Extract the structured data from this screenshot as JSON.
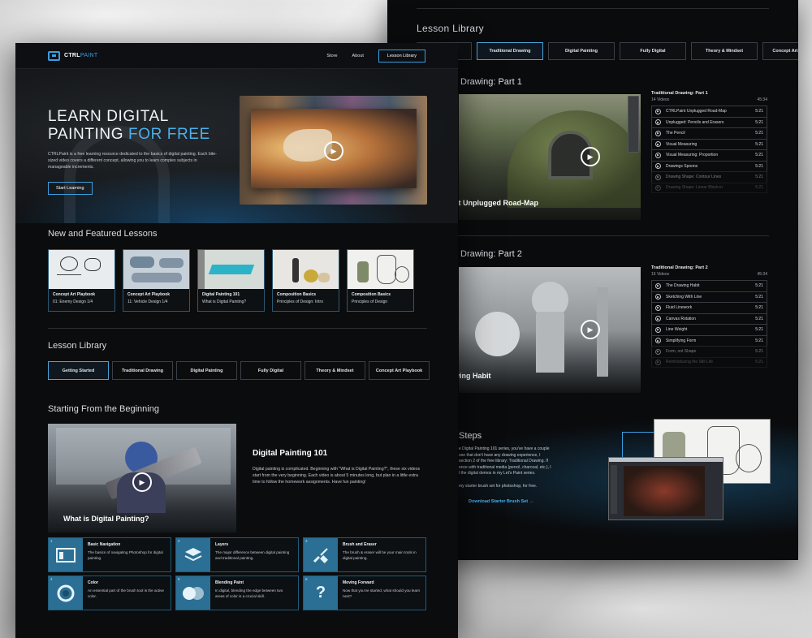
{
  "back_page": {
    "lesson_library_title": "Lesson Library",
    "tabs": [
      {
        "label": "",
        "active": false
      },
      {
        "label": "Traditional Drawing",
        "active": true
      },
      {
        "label": "Digital Painting",
        "active": false
      },
      {
        "label": "Fully Digital",
        "active": false
      },
      {
        "label": "Theory & Mindset",
        "active": false
      },
      {
        "label": "Concept Art Playbook",
        "active": false
      }
    ],
    "section1": {
      "title": "Drawing: Part 1",
      "video_label": "nt Unplugged Road-Map",
      "playlist_title": "Traditional Drawing: Part 1",
      "video_count": "14 Videos",
      "duration": "45:34",
      "items": [
        {
          "title": "CTRLPaint Unplugged Road-Map",
          "time": "5:21"
        },
        {
          "title": "Unplugged: Pencils and Erasers",
          "time": "5:21"
        },
        {
          "title": "The Pencil",
          "time": "5:21"
        },
        {
          "title": "Visual Measuring",
          "time": "5:21"
        },
        {
          "title": "Visual Measuring: Proportion",
          "time": "5:21"
        },
        {
          "title": "Drawings Spoons",
          "time": "5:21"
        },
        {
          "title": "Drawing Shape: Contour Lines",
          "time": "5:21"
        },
        {
          "title": "Drawing Shape: Linear Block-in",
          "time": "5:21"
        }
      ]
    },
    "section2": {
      "title": "Drawing: Part 2",
      "video_label": "wing Habit",
      "playlist_title": "Traditional Drawing: Part 2",
      "video_count": "16 Videos",
      "duration": "45:34",
      "items": [
        {
          "title": "The Drawing Habit",
          "time": "5:21"
        },
        {
          "title": "Sketching With Line",
          "time": "5:21"
        },
        {
          "title": "Fluid Linework",
          "time": "5:21"
        },
        {
          "title": "Canvas Rotation",
          "time": "5:21"
        },
        {
          "title": "Line Weight",
          "time": "5:21"
        },
        {
          "title": "Simplifying Form",
          "time": "5:21"
        },
        {
          "title": "Form, not Shape",
          "time": "5:21"
        },
        {
          "title": "Reintroducing the Still Life",
          "time": "5:21"
        }
      ]
    },
    "next_steps": {
      "title": "Steps",
      "text": "e Digital Painting 101 series, you've have a couple\nose that don't have any drawing experience, I\nsection 2 of the free library: Traditional Drawing. If\nence with traditional media (pencil, charcoal, etc.), I\nl the digital demos in my Let's Paint series.\n\nmy starter brush set for photoshop, for free.",
      "link": "Download Starter Brush Set"
    }
  },
  "front_page": {
    "nav": {
      "logo_a": "CTRL",
      "logo_b": "PAINT",
      "store": "Store",
      "about": "About",
      "library_button": "Lesson Library"
    },
    "hero": {
      "line1": "LEARN DIGITAL",
      "line2a": "PAINTING ",
      "line2b": "FOR FREE",
      "description": "CTRLPaint is a free learning resource dedicated to the basics of digital painting. Each bite-sized video covers a different concept, allowing you to learn complex subjects in manageable increments.",
      "button": "Start Learning"
    },
    "featured": {
      "title": "New and Featured Lessons",
      "cards": [
        {
          "category": "Concept Art Playbook",
          "title": "01: Enemy Design 1/4"
        },
        {
          "category": "Concept Art Playbook",
          "title": "11: Vehicle Design 1/4"
        },
        {
          "category": "Digital Painting 101",
          "title": "What is Digital Painting?"
        },
        {
          "category": "Composition Basics",
          "title": "Principles of Design: Intro"
        },
        {
          "category": "Composition Basics",
          "title": "Principles of Design"
        }
      ]
    },
    "library": {
      "title": "Lesson Library",
      "tabs": [
        {
          "label": "Getting Started",
          "active": true
        },
        {
          "label": "Traditional Drawing",
          "active": false
        },
        {
          "label": "Digital Painting",
          "active": false
        },
        {
          "label": "Fully Digital",
          "active": false
        },
        {
          "label": "Theory & Mindset",
          "active": false
        },
        {
          "label": "Concept Art Playbook",
          "active": false
        }
      ]
    },
    "beginning": {
      "title": "Starting From the Beginning",
      "video_title": "What is Digital Painting?",
      "course_title": "Digital Painting 101",
      "course_desc": "Digital painting is complicated.  Beginning with \"What is Digital Painting?\", these six videos start from the very beginning.  Each video is about 5 minutes long, but plan in a little extra time to follow the homework assignments.  Have fun painting!",
      "lessons": [
        {
          "num": "1",
          "title": "Basic Navigation",
          "desc": "The basics of navigating Photoshop for digital painting.",
          "icon": "window-icon"
        },
        {
          "num": "2",
          "title": "Layers",
          "desc": "The major difference between digital painting and traditional painting.",
          "icon": "layers-icon"
        },
        {
          "num": "3",
          "title": "Brush and Eraser",
          "desc": "The brush & eraser will be your main tools in digital painting.",
          "icon": "brush-icon"
        },
        {
          "num": "4",
          "title": "Color",
          "desc": "An essential part of the brush tool is the active color.",
          "icon": "color-ring-icon"
        },
        {
          "num": "5",
          "title": "Blending Paint",
          "desc": "In digital, blending the edge between two areas of color is a crucial skill.",
          "icon": "blend-icon"
        },
        {
          "num": "6",
          "title": "Moving Forward",
          "desc": "Now that you've started, what should you learn next?",
          "icon": "question-icon"
        }
      ]
    }
  },
  "colors": {
    "accent": "#3a9ee0",
    "background": "#0b0c0e",
    "tile": "#2b6f95"
  }
}
